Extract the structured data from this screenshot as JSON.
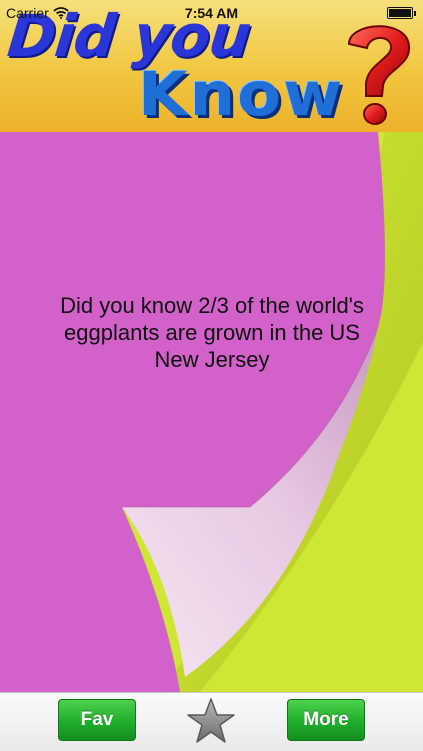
{
  "status_bar": {
    "carrier": "Carrier",
    "time": "7:54 AM"
  },
  "header": {
    "title_line1": "Did you",
    "title_line2": "Know",
    "title_mark": "?"
  },
  "fact": {
    "line1": "Did you know 2/3 of the world's",
    "line2": "eggplants are grown in the US",
    "line3": "New Jersey"
  },
  "toolbar": {
    "fav_label": "Fav",
    "more_label": "More",
    "favorite_icon": "star-icon"
  },
  "colors": {
    "note": "#d262c9",
    "note_backside": "#efd6ea",
    "background": "#cfe635",
    "banner": "#f1c640",
    "title_blue": "#2b36d8",
    "qmark_red": "#e21b1b",
    "button_green": "#1fae2a"
  }
}
